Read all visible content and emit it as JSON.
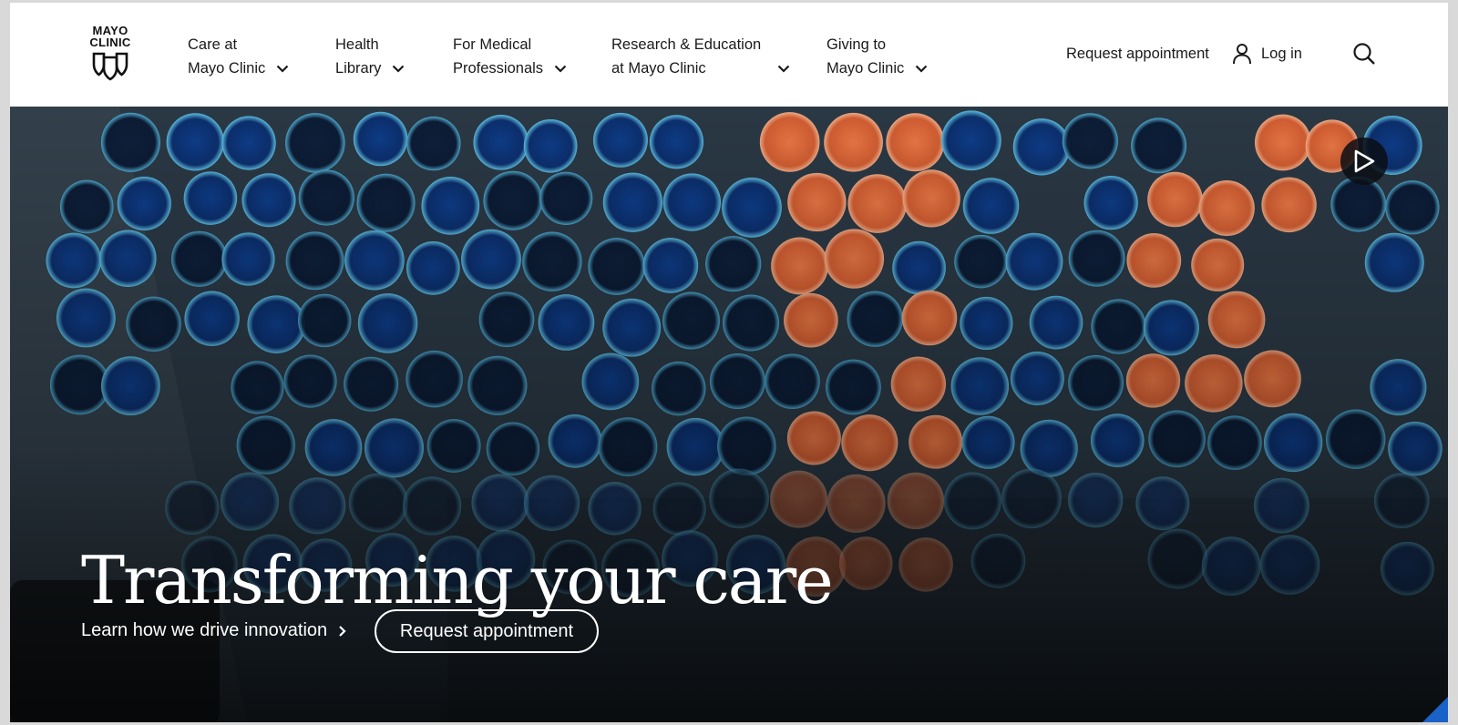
{
  "logo": {
    "line1": "MAYO",
    "line2": "CLINIC"
  },
  "nav": [
    {
      "line1": "Care at",
      "line2": "Mayo Clinic"
    },
    {
      "line1": "Health",
      "line2": "Library"
    },
    {
      "line1": "For Medical",
      "line2": "Professionals"
    },
    {
      "line1": "Research & Education",
      "line2": "at Mayo Clinic"
    },
    {
      "line1": "Giving to",
      "line2": "Mayo Clinic"
    }
  ],
  "utility": {
    "request_appointment": "Request appointment",
    "login": "Log in"
  },
  "hero": {
    "title": "Transforming your care",
    "link": "Learn how we drive innovation",
    "button": "Request appointment"
  },
  "colors": {
    "accent_corner": "#1b62c8",
    "petri_blue": "#0f3f8c",
    "petri_orange": "#e2683a"
  },
  "icons": [
    "chevron-down-icon",
    "user-icon",
    "search-icon",
    "play-icon",
    "chevron-right-icon"
  ]
}
